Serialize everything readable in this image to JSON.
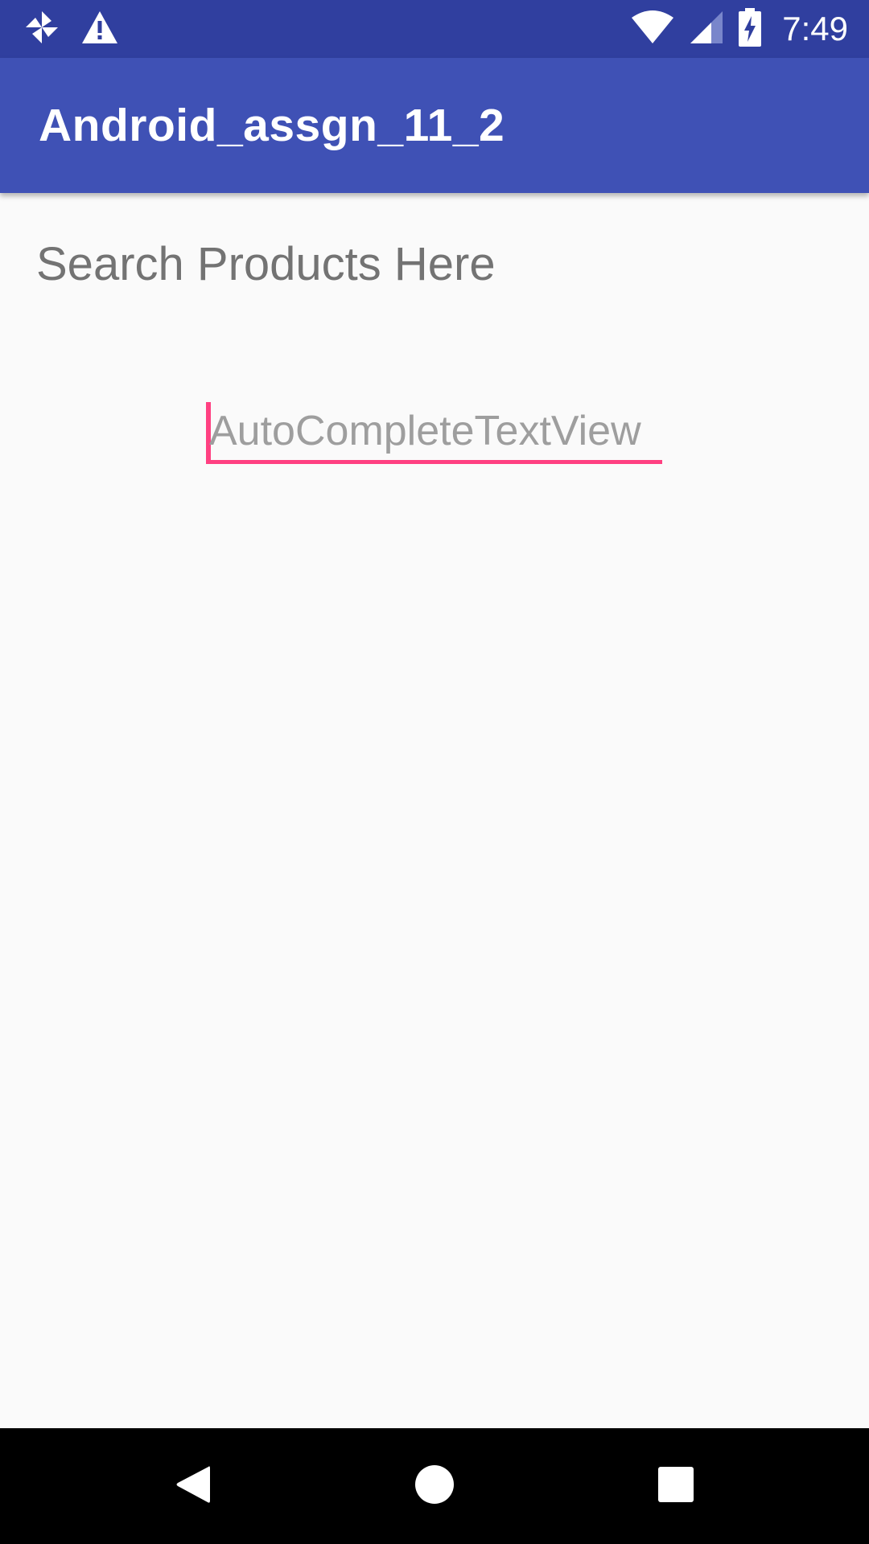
{
  "status_bar": {
    "time": "7:49",
    "icons_left": [
      "pinwheel-icon",
      "warning-icon"
    ],
    "icons_right": [
      "wifi-icon",
      "cell-signal-icon",
      "battery-charging-icon"
    ],
    "background": "#303F9F"
  },
  "app_bar": {
    "title": "Android_assgn_11_2",
    "background": "#3F51B5"
  },
  "main": {
    "heading": "Search Products Here",
    "search_field": {
      "placeholder": "AutoCompleteTextView",
      "value": "",
      "accent_color": "#FF4081"
    }
  },
  "nav_bar": {
    "buttons": [
      "back-icon",
      "home-icon",
      "recents-icon"
    ]
  }
}
